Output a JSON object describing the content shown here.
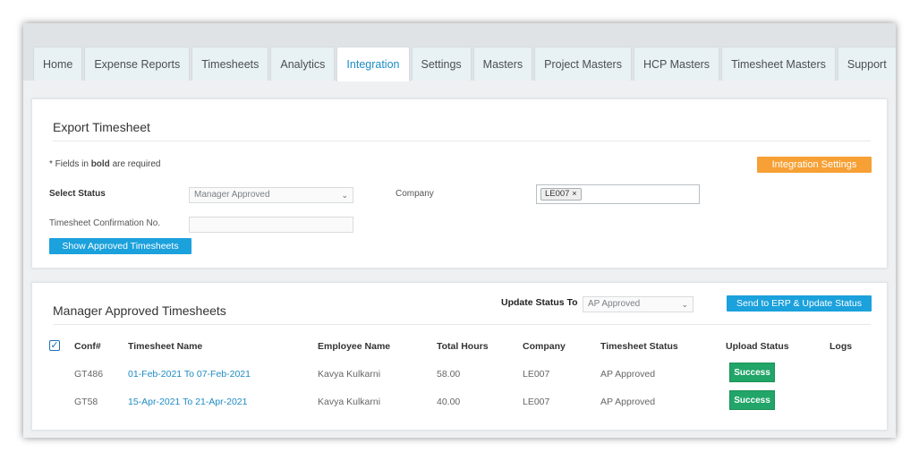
{
  "tabs": [
    {
      "label": "Home",
      "active": false
    },
    {
      "label": "Expense Reports",
      "active": false
    },
    {
      "label": "Timesheets",
      "active": false
    },
    {
      "label": "Analytics",
      "active": false
    },
    {
      "label": "Integration",
      "active": true
    },
    {
      "label": "Settings",
      "active": false
    },
    {
      "label": "Masters",
      "active": false
    },
    {
      "label": "Project Masters",
      "active": false
    },
    {
      "label": "HCP Masters",
      "active": false
    },
    {
      "label": "Timesheet Masters",
      "active": false
    },
    {
      "label": "Support",
      "active": false
    }
  ],
  "export": {
    "title": "Export Timesheet",
    "required_note_prefix": "* Fields in ",
    "required_note_bold": "bold",
    "required_note_suffix": " are required",
    "integration_settings_label": "Integration Settings",
    "select_status_label": "Select Status",
    "select_status_value": "Manager Approved",
    "company_label": "Company",
    "company_tag": "LE007",
    "confirmation_label": "Timesheet Confirmation No.",
    "confirmation_value": "",
    "show_button_label": "Show Approved Timesheets"
  },
  "approved": {
    "title": "Manager Approved Timesheets",
    "update_status_label": "Update Status To",
    "update_status_value": "AP Approved",
    "send_button_label": "Send to ERP & Update Status",
    "columns": [
      "Conf#",
      "Timesheet Name",
      "Employee Name",
      "Total Hours",
      "Company",
      "Timesheet Status",
      "Upload Status",
      "Logs"
    ],
    "rows": [
      {
        "conf": "GT486",
        "name": "01-Feb-2021 To 07-Feb-2021",
        "employee": "Kavya Kulkarni",
        "hours": "58.00",
        "company": "LE007",
        "status": "AP Approved",
        "upload": "Success",
        "logs": ""
      },
      {
        "conf": "GT58",
        "name": "15-Apr-2021 To 21-Apr-2021",
        "employee": "Kavya Kulkarni",
        "hours": "40.00",
        "company": "LE007",
        "status": "AP Approved",
        "upload": "Success",
        "logs": ""
      }
    ]
  },
  "colors": {
    "accent_blue": "#1ba1dc",
    "link_blue": "#1e8bc3",
    "orange": "#f7a035",
    "success_green": "#21a568"
  }
}
